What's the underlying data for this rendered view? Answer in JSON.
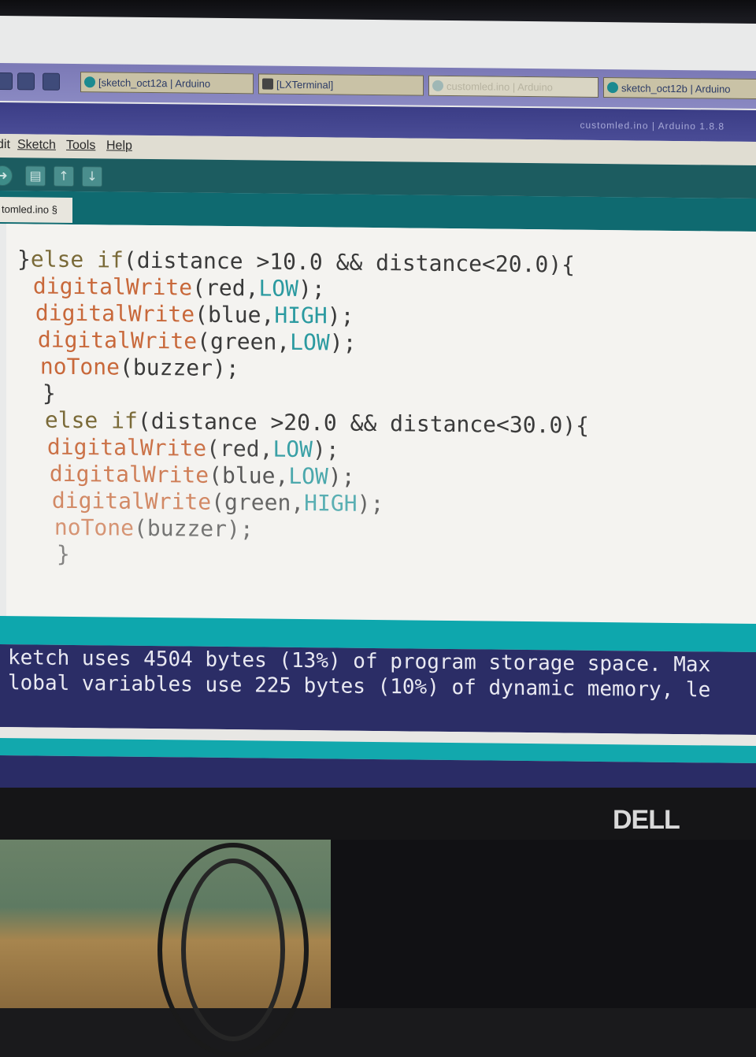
{
  "taskbar": {
    "windows": [
      {
        "label": "[sketch_oct12a | Arduino"
      },
      {
        "label": "[LXTerminal]"
      },
      {
        "label": "customled.ino | Arduino"
      },
      {
        "label": "sketch_oct12b | Arduino"
      }
    ]
  },
  "window": {
    "title": "customled.ino | Arduino 1.8.8"
  },
  "menu": {
    "items": [
      "dit",
      "Sketch",
      "Tools",
      "Help"
    ]
  },
  "toolbar": {
    "icons": [
      "upload-icon",
      "new-icon",
      "open-icon",
      "save-icon"
    ],
    "glyphs": [
      "➜",
      "▤",
      "↑",
      "↓"
    ]
  },
  "tab": {
    "label": "tomled.ino §"
  },
  "code": {
    "lines": [
      "}else if(distance >10.0 && distance<20.0){",
      " digitalWrite(red,LOW);",
      " digitalWrite(blue,HIGH);",
      " digitalWrite(green,LOW);",
      " noTone(buzzer);",
      " }",
      " else if(distance >20.0 && distance<30.0){",
      " digitalWrite(red,LOW);",
      " digitalWrite(blue,LOW);",
      " digitalWrite(green,HIGH);",
      " noTone(buzzer);",
      " }"
    ]
  },
  "console": {
    "line1": "ketch uses 4504 bytes (13%) of program storage space. Max",
    "line2": "lobal variables use 225 bytes (10%) of dynamic memory, le"
  },
  "monitor": {
    "brand": "DELL"
  },
  "colors": {
    "keyword": "#7a6a38",
    "function": "#c8683a",
    "constant": "#2b9aa0",
    "console_bg": "#2b2d66",
    "status_teal": "#0ea7ad"
  }
}
